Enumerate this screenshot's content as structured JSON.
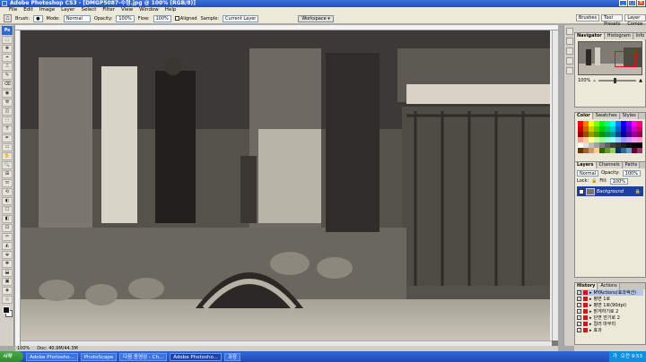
{
  "window": {
    "title": "Adobe Photoshop CS3 - [DMGP5087-수정.jpg @ 100% (RGB/8)]"
  },
  "menu": [
    "File",
    "Edit",
    "Image",
    "Layer",
    "Select",
    "Filter",
    "View",
    "Window",
    "Help"
  ],
  "options": {
    "brush_label": "Brush:",
    "mode_label": "Mode:",
    "mode_value": "Normal",
    "opacity_label": "Opacity:",
    "opacity_value": "100%",
    "flow_label": "Flow:",
    "flow_value": "100%",
    "aligned_label": "Aligned",
    "sample_label": "Sample:",
    "sample_value": "Current Layer",
    "workspace_label": "Workspace ▾"
  },
  "palette_well": [
    "Brushes",
    "Tool Presets",
    "Layer Comps"
  ],
  "toolbox": {
    "logo": "Ps",
    "tools": [
      "⬚",
      "✥",
      "⌖",
      "⎍",
      "✎",
      "⌫",
      "◉",
      "⚒",
      "◫",
      "◌",
      "T",
      "✒",
      "▭",
      "✋",
      "🔍",
      "⊞",
      "⬭",
      "⟲",
      "◐",
      "☐",
      "◧",
      "⊡",
      "✂",
      "◭",
      "⬙",
      "✚",
      "⬓",
      "▣",
      "◈",
      "◇"
    ]
  },
  "status": {
    "zoom": "100%",
    "doc": "Doc: 40.9M/44.3M"
  },
  "panels": {
    "navigator_tabs": [
      "Navigator",
      "Histogram",
      "Info"
    ],
    "nav_zoom": "100%",
    "color_tabs": [
      "Color",
      "Swatches",
      "Styles"
    ],
    "layers_tabs": [
      "Layers",
      "Channels",
      "Paths"
    ],
    "blend_mode": "Normal",
    "opacity_label": "Opacity:",
    "opacity_value": "100%",
    "lock_label": "Lock:",
    "fill_label": "Fill:",
    "fill_value": "100%",
    "layer_name": "Background",
    "history_tabs": [
      "History",
      "Actions"
    ],
    "actions": [
      {
        "label": "MYActions(효과액션)",
        "set": true
      },
      {
        "label": "평면 1로"
      },
      {
        "label": "평면 1로(90dpi)"
      },
      {
        "label": "밝게하기로 2"
      },
      {
        "label": "단면 얻기로 2"
      },
      {
        "label": "컬러 마무리"
      },
      {
        "label": "효과"
      }
    ]
  },
  "colors": {
    "swatches": [
      "#ff0000",
      "#ff8000",
      "#ffff00",
      "#80ff00",
      "#00ff00",
      "#00ff80",
      "#00ffff",
      "#0080ff",
      "#0000ff",
      "#8000ff",
      "#ff00ff",
      "#ff0080",
      "#cc0000",
      "#cc6600",
      "#cccc00",
      "#66cc00",
      "#00cc00",
      "#00cc66",
      "#00cccc",
      "#0066cc",
      "#0000cc",
      "#6600cc",
      "#cc00cc",
      "#cc0066",
      "#990000",
      "#994c00",
      "#999900",
      "#4c9900",
      "#009900",
      "#00994c",
      "#009999",
      "#004c99",
      "#000099",
      "#4c0099",
      "#990099",
      "#99004c",
      "#ff9999",
      "#ffcc99",
      "#ffff99",
      "#ccff99",
      "#99ff99",
      "#99ffcc",
      "#99ffff",
      "#99ccff",
      "#9999ff",
      "#cc99ff",
      "#ff99ff",
      "#ff99cc",
      "#ffffff",
      "#e0e0e0",
      "#c0c0c0",
      "#a0a0a0",
      "#808080",
      "#606060",
      "#404040",
      "#303030",
      "#202020",
      "#101010",
      "#080808",
      "#000000",
      "#663300",
      "#996633",
      "#cc9966",
      "#ffcc99",
      "#336600",
      "#669933",
      "#99cc66",
      "#003366",
      "#336699",
      "#6699cc",
      "#660033",
      "#993366"
    ]
  },
  "taskbar": {
    "start": "시작",
    "tasks": [
      "Adobe Photosho...",
      "PhotoScape",
      "다음 동영상 - Ch...",
      "Adobe Photosho...",
      "과장"
    ],
    "active_index": 3,
    "tray_lang": "가 ",
    "clock": "오전 9:53"
  }
}
